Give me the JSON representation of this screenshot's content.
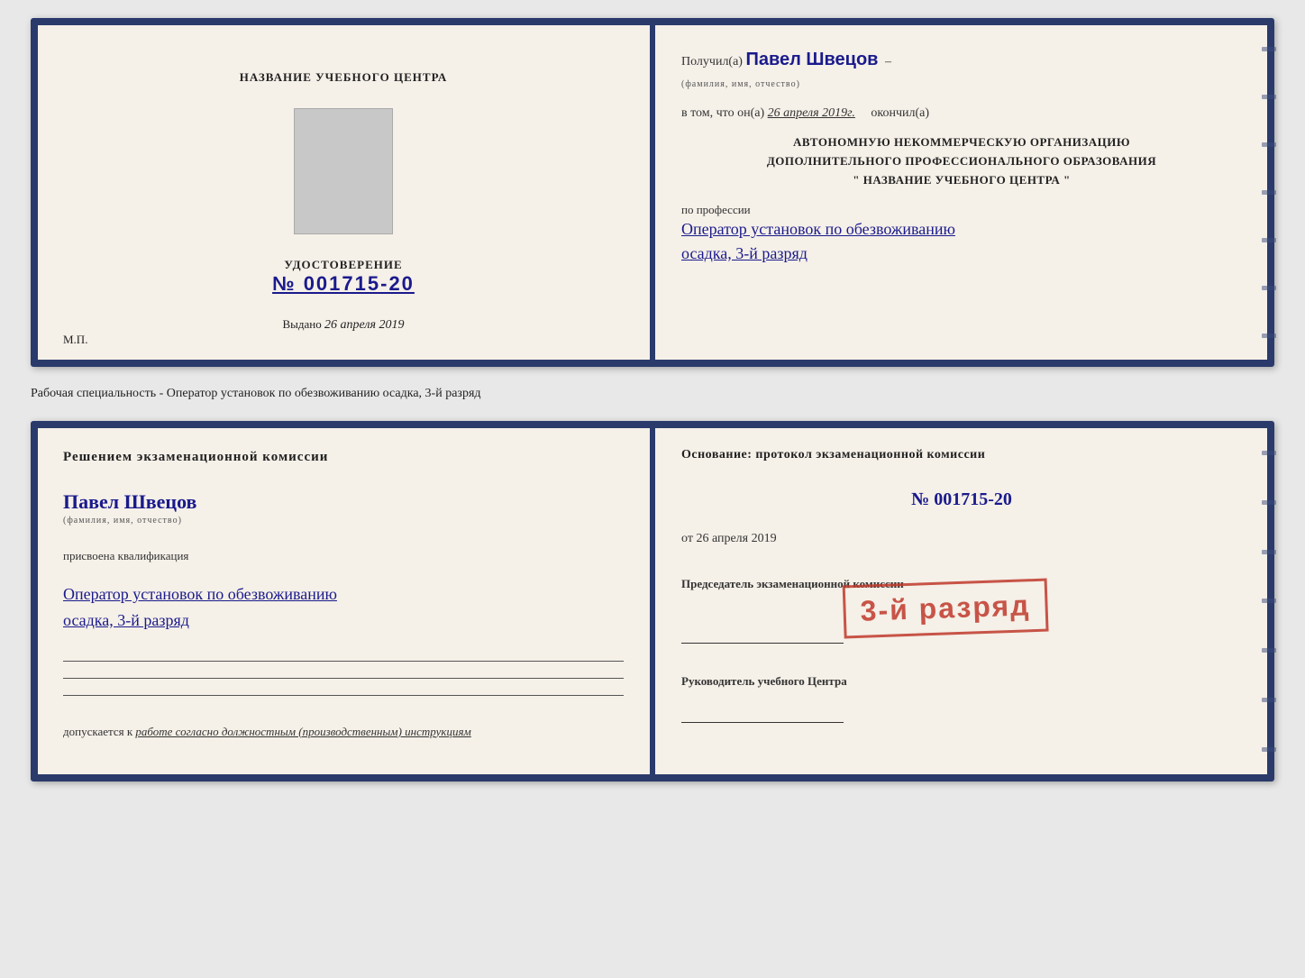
{
  "doc1": {
    "left": {
      "title": "НАЗВАНИЕ УЧЕБНОГО ЦЕНТРА",
      "cert_label": "УДОСТОВЕРЕНИЕ",
      "cert_number": "№ 001715-20",
      "issued_label": "Выдано",
      "issued_date": "26 апреля 2019",
      "mp_label": "М.П."
    },
    "right": {
      "received_label": "Получил(а)",
      "received_name": "Павел Швецов",
      "fio_sublabel": "(фамилия, имя, отчество)",
      "dash1": "–",
      "date_label": "в том, что он(а)",
      "date_value": "26 апреля 2019г.",
      "finished_label": "окончил(а)",
      "org_line1": "АВТОНОМНУЮ НЕКОММЕРЧЕСКУЮ ОРГАНИЗАЦИЮ",
      "org_line2": "ДОПОЛНИТЕЛЬНОГО ПРОФЕССИОНАЛЬНОГО ОБРАЗОВАНИЯ",
      "org_line3": "\"  НАЗВАНИЕ УЧЕБНОГО ЦЕНТРА  \"",
      "profession_label": "по профессии",
      "profession_line1": "Оператор установок по обезвоживанию",
      "profession_line2": "осадка, 3-й разряд"
    }
  },
  "separator": {
    "text": "Рабочая специальность - Оператор установок по обезвоживанию осадка, 3-й разряд"
  },
  "doc2": {
    "left": {
      "decision_title": "Решением  экзаменационной  комиссии",
      "person_name": "Павел Швецов",
      "fio_sublabel": "(фамилия, имя, отчество)",
      "qualification_label": "присвоена квалификация",
      "qualification_line1": "Оператор установок по обезвоживанию",
      "qualification_line2": "осадка, 3-й разряд",
      "allowed_label": "допускается к",
      "allowed_value": "работе согласно должностным (производственным) инструкциям"
    },
    "right": {
      "basis_title": "Основание: протокол экзаменационной  комиссии",
      "basis_number": "№  001715-20",
      "basis_date_prefix": "от",
      "basis_date": "26 апреля 2019",
      "chairman_label": "Председатель экзаменационной комиссии",
      "director_label": "Руководитель учебного Центра"
    },
    "stamp": {
      "text": "3-й разряд"
    }
  }
}
